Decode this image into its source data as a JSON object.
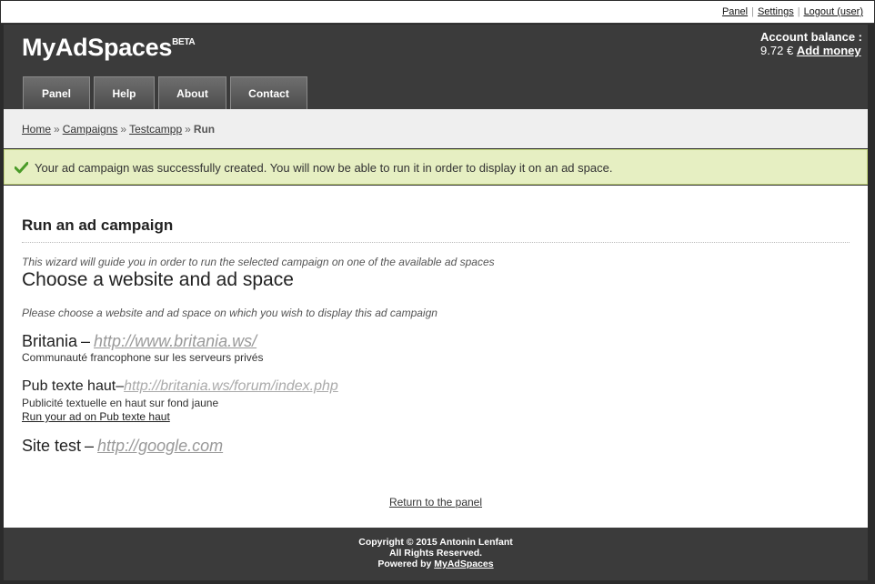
{
  "topbar": {
    "links": [
      "Panel",
      "Settings",
      "Logout (user)"
    ]
  },
  "header": {
    "logo": "MyAdSpaces",
    "logo_badge": "BETA",
    "balance_label": "Account balance :",
    "balance_value": "9.72 €",
    "add_money": "Add money"
  },
  "nav": {
    "tabs": [
      "Panel",
      "Help",
      "About",
      "Contact"
    ]
  },
  "breadcrumb": {
    "items": [
      "Home",
      "Campaigns",
      "Testcampp"
    ],
    "current": "Run",
    "separator": "»"
  },
  "notice": {
    "icon": "checkmark-icon",
    "text": "Your ad campaign was successfully created. You will now be able to run it in order to display it on an ad space.",
    "bg_color": "#e6efc2",
    "icon_color": "#4a9b28"
  },
  "main": {
    "title": "Run an ad campaign",
    "intro": "This wizard will guide you in order to run the selected campaign on one of the available ad spaces",
    "heading": "Choose a website and ad space",
    "instruction": "Please choose a website and ad space on which you wish to display this ad campaign",
    "sites": [
      {
        "name": "Britania",
        "url": "http://www.britania.ws/",
        "description": "Communauté francophone sur les serveurs privés",
        "spaces": [
          {
            "name": "Pub texte haut",
            "url": "http://britania.ws/forum/index.php",
            "description": "Publicité textuelle en haut sur fond jaune",
            "run_label": "Run your ad on Pub texte haut"
          }
        ]
      },
      {
        "name": "Site test",
        "url": "http://google.com"
      }
    ],
    "dash": "–",
    "return_label": "Return to the panel"
  },
  "footer": {
    "copyright": "Copyright © 2015 Antonin Lenfant",
    "rights": "All Rights Reserved.",
    "powered_prefix": "Powered by",
    "powered_link": "MyAdSpaces"
  }
}
